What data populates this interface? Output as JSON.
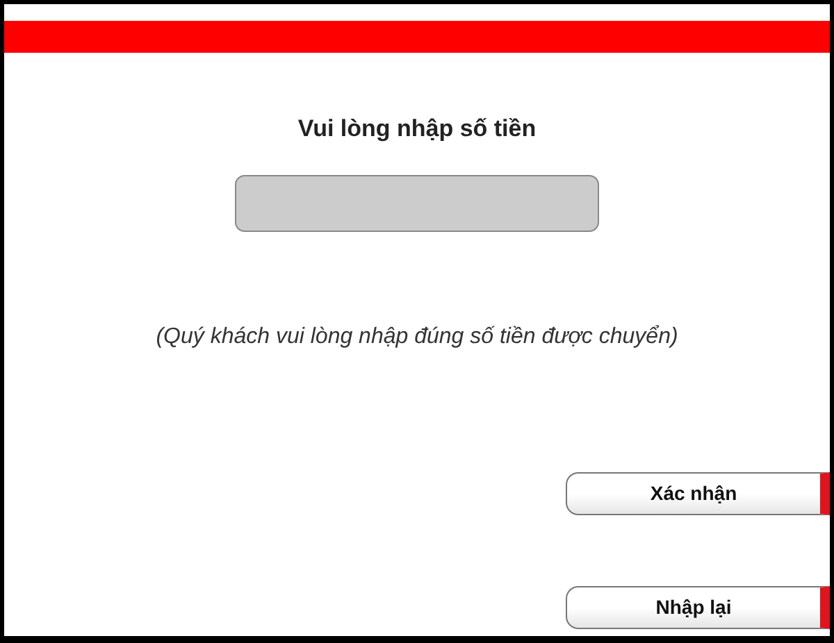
{
  "prompt": "Vui lòng nhập số tiền",
  "note": "(Quý khách vui lòng nhập đúng số tiền được chuyển)",
  "buttons": [
    {
      "label": "Xác nhận"
    },
    {
      "label": "Nhập lại"
    }
  ]
}
